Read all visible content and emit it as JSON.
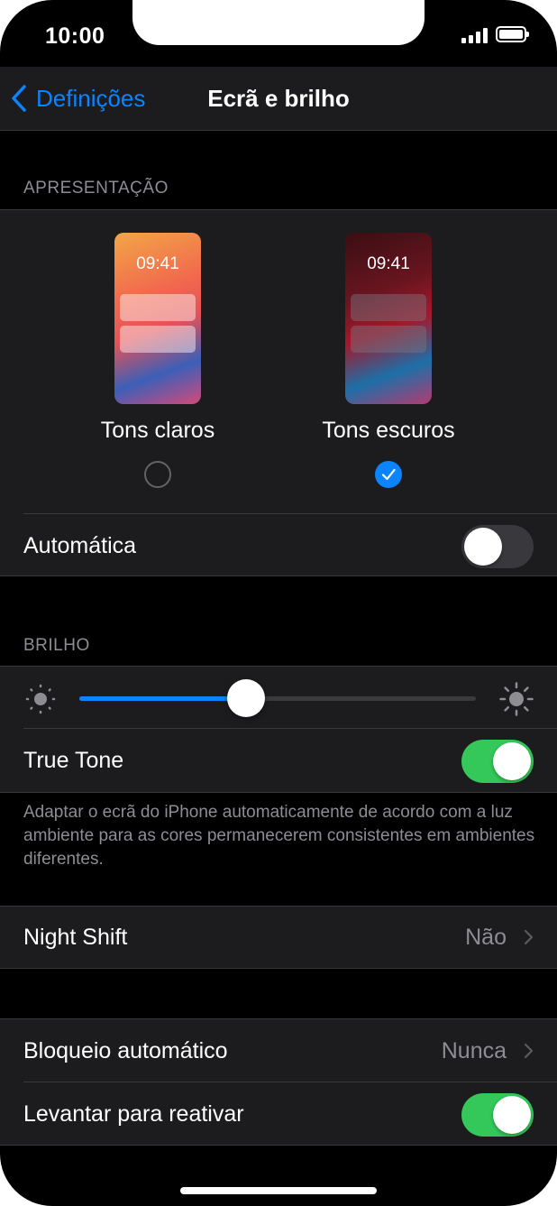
{
  "status_bar": {
    "time": "10:00"
  },
  "nav": {
    "back_label": "Definições",
    "title": "Ecrã e brilho"
  },
  "appearance": {
    "header": "APRESENTAÇÃO",
    "light": {
      "label": "Tons claros",
      "preview_time": "09:41",
      "selected": false
    },
    "dark": {
      "label": "Tons escuros",
      "preview_time": "09:41",
      "selected": true
    },
    "automatic": {
      "label": "Automática",
      "on": false
    }
  },
  "brightness": {
    "header": "BRILHO",
    "level": 0.42,
    "true_tone": {
      "label": "True Tone",
      "on": true
    },
    "note": "Adaptar o ecrã do iPhone automaticamente de acordo com a luz ambiente para as cores permanecerem consistentes em ambientes diferentes."
  },
  "night_shift": {
    "label": "Night Shift",
    "value": "Não"
  },
  "auto_lock": {
    "label": "Bloqueio automático",
    "value": "Nunca"
  },
  "raise_to_wake": {
    "label": "Levantar para reativar",
    "on": true
  },
  "colors": {
    "accent": "#0a84ff",
    "toggle_on": "#34c759",
    "background": "#000000",
    "cell": "#1c1c1e"
  }
}
